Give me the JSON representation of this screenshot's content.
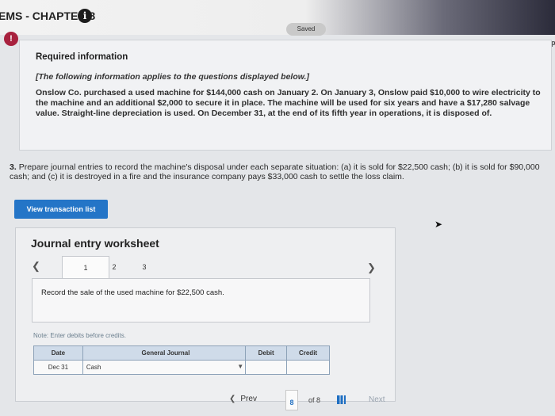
{
  "header": {
    "title": "EMS - CHAPTER 8",
    "info_icon_glyph": "i",
    "saved_label": "Saved",
    "help_label": "Help",
    "alert_icon_glyph": "!"
  },
  "required_info": {
    "title": "Required information",
    "subtitle": "[The following information applies to the questions displayed below.]",
    "body": "Onslow Co. purchased a used machine for $144,000 cash on January 2. On January 3, Onslow paid $10,000 to wire electricity to the machine and an additional $2,000 to secure it in place. The machine will be used for six years and have a $17,280 salvage value. Straight-line depreciation is used. On December 31, at the end of its fifth year in operations, it is disposed of."
  },
  "question": {
    "number": "3.",
    "text": "Prepare journal entries to record the machine's disposal under each separate situation: (a) it is sold for $22,500 cash; (b) it is sold for $90,000 cash; and (c) it is destroyed in a fire and the insurance company pays $33,000 cash to settle the loss claim."
  },
  "view_transaction_label": "View transaction list",
  "worksheet": {
    "title": "Journal entry worksheet",
    "tabs": [
      "1",
      "2",
      "3"
    ],
    "active_tab": "1",
    "record_text": "Record the sale of the used machine for $22,500 cash.",
    "note": "Note: Enter debits before credits.",
    "table": {
      "headers": [
        "Date",
        "General Journal",
        "Debit",
        "Credit"
      ],
      "rows": [
        {
          "date": "Dec 31",
          "account": "Cash",
          "debit": "",
          "credit": ""
        }
      ]
    }
  },
  "pager": {
    "prev_label": "Prev",
    "current_page": "8",
    "total_label": "of 8",
    "next_label": "Next"
  },
  "colors": {
    "primary_button": "#2475c7",
    "alert": "#a8213e",
    "table_header": "#cfdbe9"
  }
}
